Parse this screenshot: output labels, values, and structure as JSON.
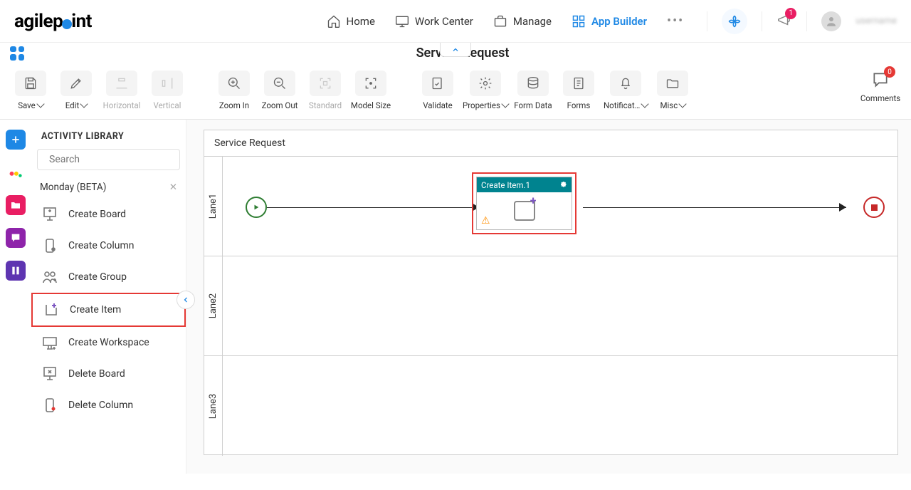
{
  "header": {
    "logo_text_a": "agilep",
    "logo_text_b": "int",
    "nav": {
      "home": "Home",
      "work_center": "Work Center",
      "manage": "Manage",
      "app_builder": "App Builder"
    },
    "notif_badge": "1",
    "username": "username"
  },
  "page_title": "Service Request",
  "toolbar": {
    "save": "Save",
    "edit": "Edit",
    "horizontal": "Horizontal",
    "vertical": "Vertical",
    "zoom_in": "Zoom In",
    "zoom_out": "Zoom Out",
    "standard": "Standard",
    "model_size": "Model Size",
    "validate": "Validate",
    "properties": "Properties",
    "form_data": "Form Data",
    "forms": "Forms",
    "notifications": "Notificat…",
    "misc": "Misc",
    "comments": "Comments",
    "comments_badge": "0"
  },
  "sidebar": {
    "title": "ACTIVITY LIBRARY",
    "search_placeholder": "Search",
    "category": "Monday (BETA)",
    "items": [
      {
        "label": "Create Board"
      },
      {
        "label": "Create Column"
      },
      {
        "label": "Create Group"
      },
      {
        "label": "Create Item"
      },
      {
        "label": "Create Workspace"
      },
      {
        "label": "Delete Board"
      },
      {
        "label": "Delete Column"
      }
    ]
  },
  "canvas": {
    "title": "Service Request",
    "lanes": [
      "Lane1",
      "Lane2",
      "Lane3"
    ],
    "activity": {
      "title": "Create Item.1"
    }
  }
}
